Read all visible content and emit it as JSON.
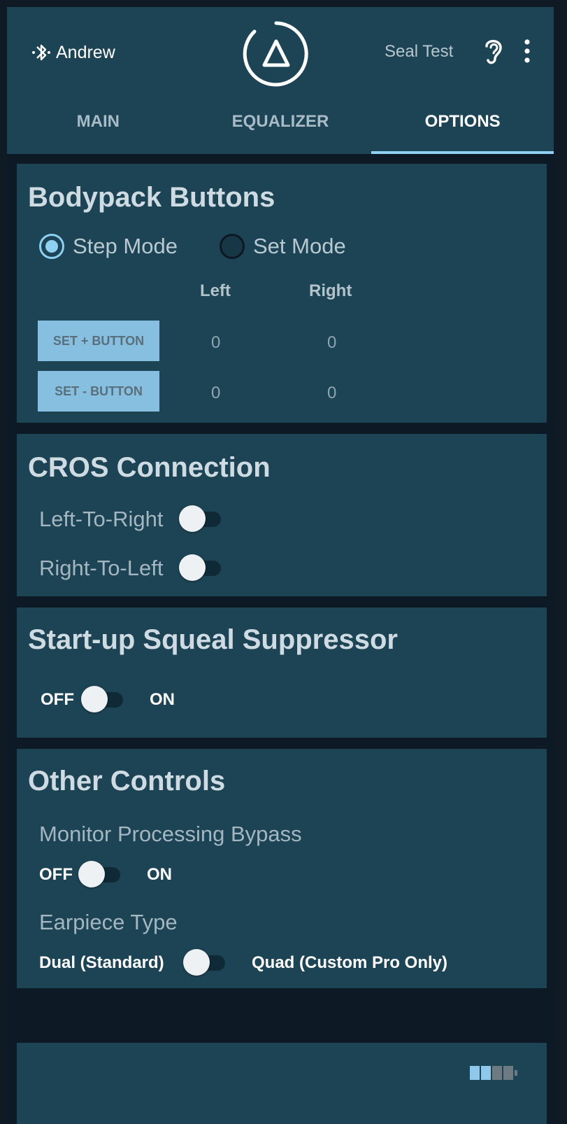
{
  "header": {
    "device_name": "Andrew",
    "seal_test_label": "Seal Test",
    "icons": [
      "bluetooth-icon",
      "app-logo-icon",
      "ear-icon",
      "more-vert-icon"
    ]
  },
  "tabs": [
    {
      "label": "MAIN",
      "active": false
    },
    {
      "label": "EQUALIZER",
      "active": false
    },
    {
      "label": "OPTIONS",
      "active": true
    }
  ],
  "colors": {
    "accent": "#8ed1f2",
    "panel": "#1d4455",
    "background": "#0e1926",
    "button": "#86bfdf"
  },
  "bodypack": {
    "title": "Bodypack Buttons",
    "modes": [
      {
        "label": "Step Mode",
        "selected": true
      },
      {
        "label": "Set Mode",
        "selected": false
      }
    ],
    "col_left": "Left",
    "col_right": "Right",
    "rows": [
      {
        "button": "SET + BUTTON",
        "left": "0",
        "right": "0"
      },
      {
        "button": "SET - BUTTON",
        "left": "0",
        "right": "0"
      }
    ]
  },
  "cros": {
    "title": "CROS Connection",
    "toggles": [
      {
        "label": "Left-To-Right",
        "on": false
      },
      {
        "label": "Right-To-Left",
        "on": false
      }
    ]
  },
  "squeal": {
    "title": "Start-up Squeal Suppressor",
    "off_label": "OFF",
    "on_label": "ON",
    "on": false
  },
  "other": {
    "title": "Other Controls",
    "bypass_label": "Monitor Processing Bypass",
    "bypass_off": "OFF",
    "bypass_on": "ON",
    "bypass_state": false,
    "earpiece_label": "Earpiece Type",
    "earpiece_left": "Dual (Standard)",
    "earpiece_right": "Quad (Custom Pro Only)",
    "earpiece_quad": false
  },
  "status": {
    "battery_level": 0.5
  }
}
